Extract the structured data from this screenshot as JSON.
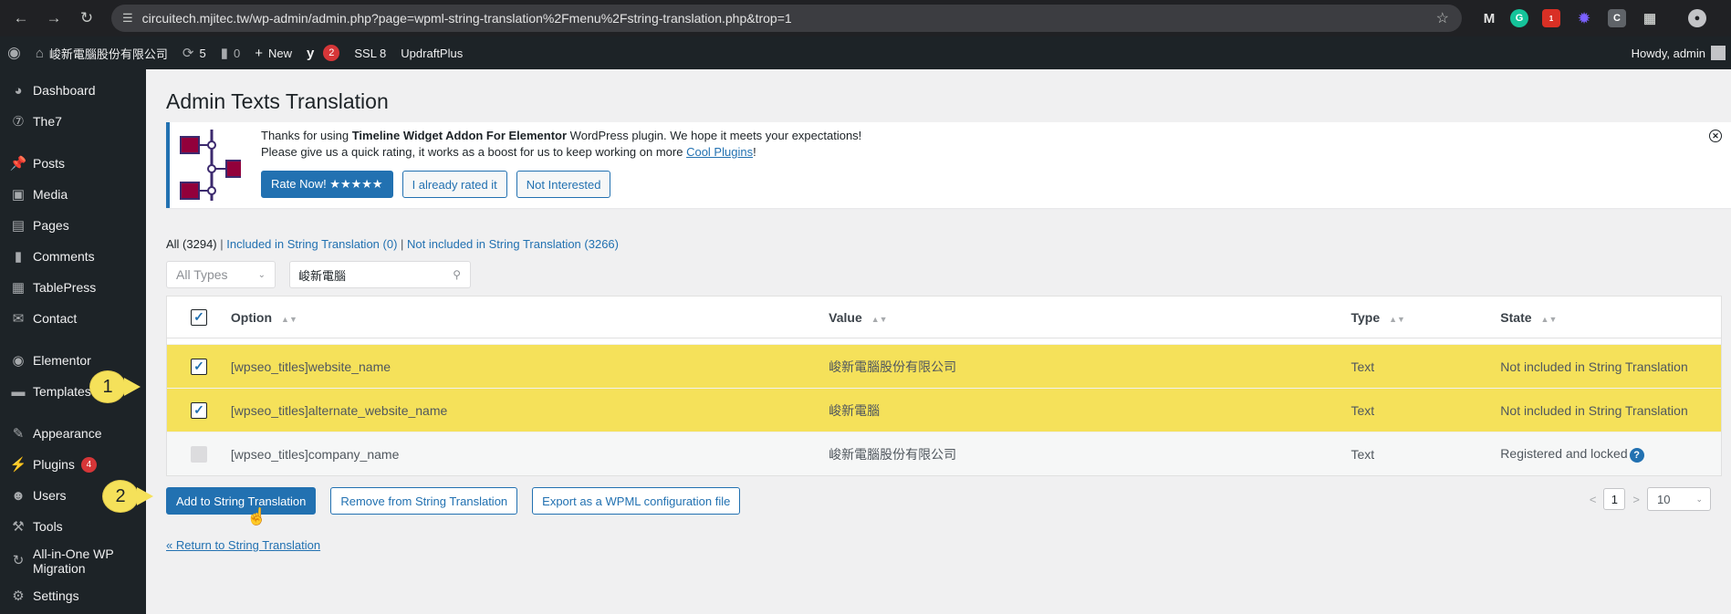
{
  "browser": {
    "url": "circuitech.mjitec.tw/wp-admin/admin.php?page=wpml-string-translation%2Fmenu%2Fstring-translation.php&trop=1"
  },
  "adminbar": {
    "site_name": "峻新電腦股份有限公司",
    "updates_count": "5",
    "comments_count": "0",
    "new_label": "New",
    "yoast_badge": "2",
    "ssl_label": "SSL 8",
    "updraft_label": "UpdraftPlus",
    "howdy": "Howdy, admin"
  },
  "sidebar": {
    "items": [
      {
        "label": "Dashboard"
      },
      {
        "label": "The7"
      },
      {
        "label": "Posts"
      },
      {
        "label": "Media"
      },
      {
        "label": "Pages"
      },
      {
        "label": "Comments"
      },
      {
        "label": "TablePress"
      },
      {
        "label": "Contact"
      },
      {
        "label": "Elementor"
      },
      {
        "label": "Templates"
      },
      {
        "label": "Appearance"
      },
      {
        "label": "Plugins",
        "badge": "4"
      },
      {
        "label": "Users"
      },
      {
        "label": "Tools"
      },
      {
        "label": "All-in-One WP Migration"
      },
      {
        "label": "Settings"
      }
    ]
  },
  "page": {
    "title": "Admin Texts Translation"
  },
  "notice": {
    "line1_prefix": "Thanks for using ",
    "plugin_name": "Timeline Widget Addon For Elementor",
    "line1_suffix": " WordPress plugin. We hope it meets your expectations!",
    "line2_prefix": "Please give us a quick rating, it works as a boost for us to keep working on more ",
    "line2_link": "Cool Plugins",
    "line2_suffix": "!",
    "rate_button": "Rate Now! ★★★★★",
    "rated_button": "I already rated it",
    "not_interested_button": "Not Interested"
  },
  "filters": {
    "all": "All (3294)",
    "included": "Included in String Translation (0)",
    "not_included": "Not included in String Translation (3266)",
    "type_select": "All Types",
    "search_value": "峻新電腦"
  },
  "table": {
    "headers": {
      "option": "Option",
      "value": "Value",
      "type": "Type",
      "state": "State"
    },
    "rows": [
      {
        "option": "[wpseo_titles]website_name",
        "value": "峻新電腦股份有限公司",
        "type": "Text",
        "state": "Not included in String Translation"
      },
      {
        "option": "[wpseo_titles]alternate_website_name",
        "value": "峻新電腦",
        "type": "Text",
        "state": "Not included in String Translation"
      },
      {
        "option": "[wpseo_titles]company_name",
        "value": "峻新電腦股份有限公司",
        "type": "Text",
        "state": "Registered and locked"
      }
    ]
  },
  "actions": {
    "add": "Add to String Translation",
    "remove": "Remove from String Translation",
    "export": "Export as a WPML configuration file",
    "return_link": "« Return to String Translation"
  },
  "pagination": {
    "prev": "<",
    "page": "1",
    "next": ">",
    "per_page": "10"
  },
  "callouts": {
    "first": "1",
    "second": "2"
  },
  "colors": {
    "accent": "#2271b1",
    "highlight": "#f5e15a",
    "admin_dark": "#1d2327"
  }
}
